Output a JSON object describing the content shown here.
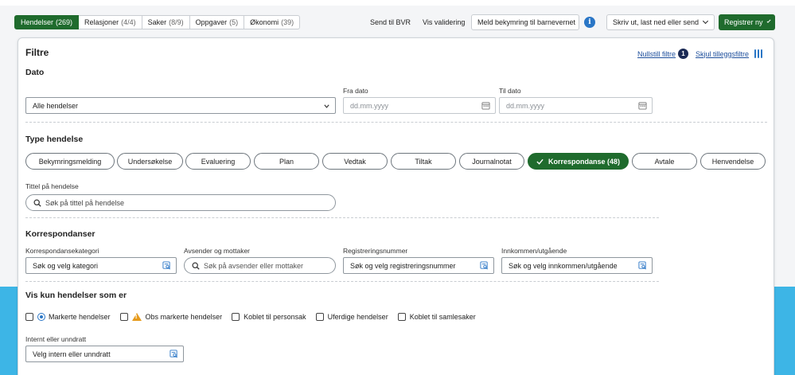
{
  "tabs": [
    {
      "label": "Hendelser",
      "count": "(269)",
      "active": true
    },
    {
      "label": "Relasjoner",
      "count": "(4/4)"
    },
    {
      "label": "Saker",
      "count": "(8/9)"
    },
    {
      "label": "Oppgaver",
      "count": "(5)"
    },
    {
      "label": "Økonomi",
      "count": "(39)"
    }
  ],
  "actions": {
    "send_bvr": "Send til BVR",
    "validation": "Vis validering",
    "report_concern": "Meld bekymring til barnevernet",
    "print_menu": "Skriv ut, last ned eller send",
    "register_new": "Registrer ny"
  },
  "filters": {
    "title": "Filtre",
    "reset_link": "Nullstill filtre",
    "reset_count": "1",
    "hide_link": "Skjul tilleggsfiltre",
    "date": {
      "heading": "Dato",
      "select_value": "Alle hendelser",
      "from_label": "Fra dato",
      "from_placeholder": "dd.mm.yyyy",
      "to_label": "Til dato",
      "to_placeholder": "dd.mm.yyyy"
    },
    "type": {
      "heading": "Type hendelse",
      "pills": [
        "Bekymringsmelding",
        "Undersøkelse",
        "Evaluering",
        "Plan",
        "Vedtak",
        "Tiltak",
        "Journalnotat",
        "Korrespondanse (48)",
        "Avtale",
        "Henvendelse"
      ],
      "active_pill": "Korrespondanse (48)",
      "title_label": "Tittel på hendelse",
      "title_placeholder": "Søk på tittel på hendelse"
    },
    "correspondence": {
      "heading": "Korrespondanser",
      "category_label": "Korrespondansekategori",
      "category_value": "Søk og velg kategori",
      "sender_label": "Avsender og mottaker",
      "sender_placeholder": "Søk på avsender eller mottaker",
      "regnum_label": "Registreringsnummer",
      "regnum_value": "Søk og velg registreringsnummer",
      "inout_label": "Innkommen/utgående",
      "inout_value": "Søk og velg innkommen/utgående"
    },
    "only": {
      "heading": "Vis kun hendelser som er",
      "marked": "Markerte hendelser",
      "obs_marked": "Obs markerte hendelser",
      "linked_personal": "Koblet til personsak",
      "unfinished": "Uferdige hendelser",
      "linked_collection": "Koblet til samlesaker"
    },
    "internal": {
      "label": "Internt eller unndratt",
      "value": "Velg intern eller unndratt"
    }
  },
  "colors": {
    "primary_green": "#1f6b2d",
    "link_blue": "#1e4f9c",
    "info_blue": "#2a76c6",
    "badge_navy": "#1b2a55",
    "warning_orange": "#e69b1d",
    "bottom_band": "#3db5e6"
  }
}
